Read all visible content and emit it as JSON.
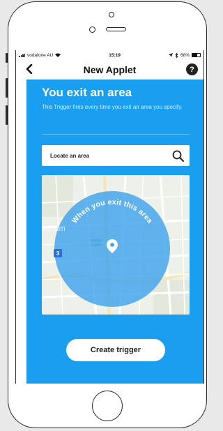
{
  "status_bar": {
    "carrier": "vodafone AU",
    "time": "15:19",
    "battery": "68%",
    "battery_level": 0.68
  },
  "nav": {
    "title": "New Applet",
    "back_icon": "chevron-left-icon",
    "help_label": "?"
  },
  "trigger": {
    "heading": "You exit an area",
    "description": "This Trigger fires every time you exit an area you specify.",
    "search_placeholder": "Locate an area",
    "search_icon": "search-icon",
    "map_overlay_text": "When you exit this area",
    "map_place_label": "enham",
    "map_route_badge": "3",
    "create_button": "Create trigger"
  },
  "colors": {
    "accent": "#1a9eef",
    "geofence": "#3fa2ec",
    "background": "#e9e9e9"
  }
}
